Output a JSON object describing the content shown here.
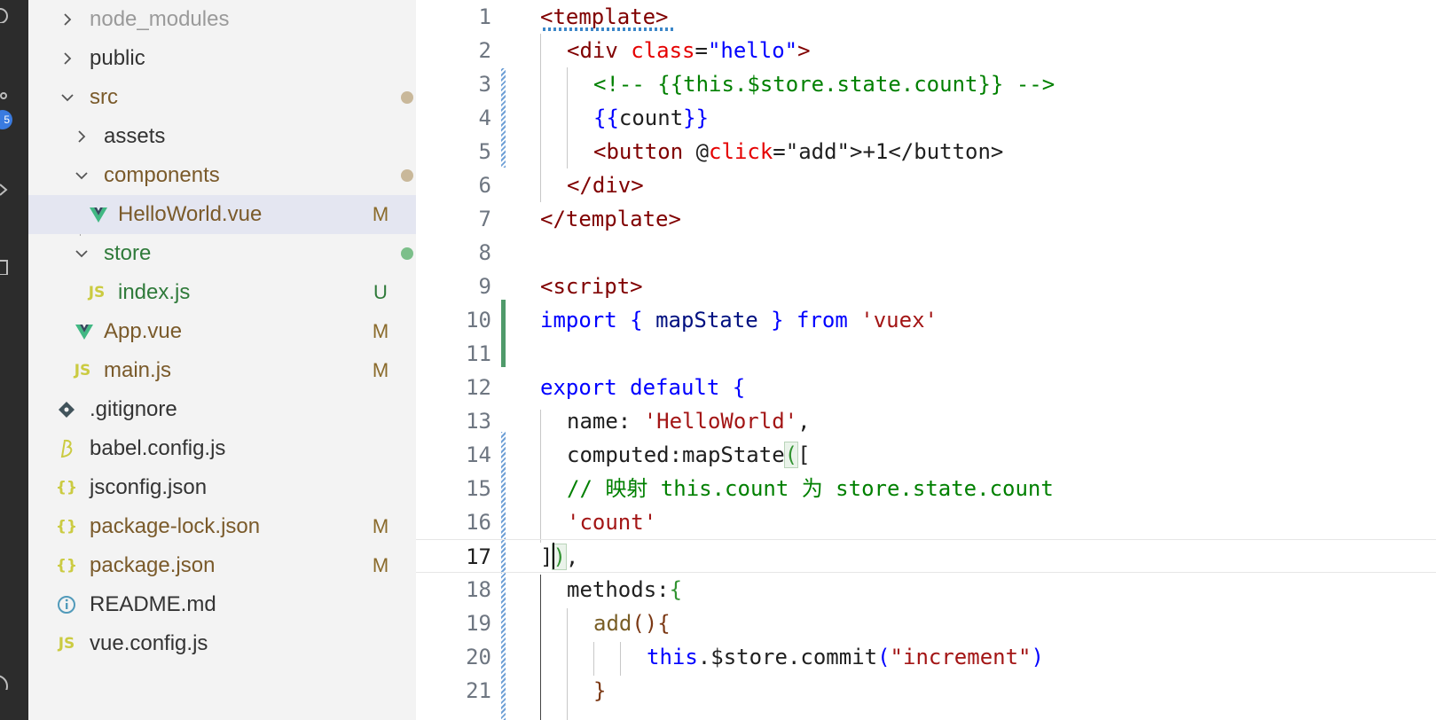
{
  "activity_bar": {
    "badge": "5"
  },
  "explorer": {
    "items": [
      {
        "label": "node_modules",
        "status": "",
        "type": "folder"
      },
      {
        "label": "public",
        "status": "",
        "type": "folder"
      },
      {
        "label": "src",
        "status": "",
        "type": "folder"
      },
      {
        "label": "assets",
        "status": "",
        "type": "folder"
      },
      {
        "label": "components",
        "status": "",
        "type": "folder"
      },
      {
        "label": "HelloWorld.vue",
        "status": "M",
        "type": "vue"
      },
      {
        "label": "store",
        "status": "",
        "type": "folder"
      },
      {
        "label": "index.js",
        "status": "U",
        "type": "js"
      },
      {
        "label": "App.vue",
        "status": "M",
        "type": "vue"
      },
      {
        "label": "main.js",
        "status": "M",
        "type": "js"
      },
      {
        "label": ".gitignore",
        "status": "",
        "type": "git"
      },
      {
        "label": "babel.config.js",
        "status": "",
        "type": "babel"
      },
      {
        "label": "jsconfig.json",
        "status": "",
        "type": "json"
      },
      {
        "label": "package-lock.json",
        "status": "M",
        "type": "json"
      },
      {
        "label": "package.json",
        "status": "M",
        "type": "json"
      },
      {
        "label": "README.md",
        "status": "",
        "type": "info"
      },
      {
        "label": "vue.config.js",
        "status": "",
        "type": "js"
      }
    ],
    "icons": {
      "js": "JS",
      "json": "{}",
      "vue": "V"
    }
  },
  "editor": {
    "line_numbers": [
      "1",
      "2",
      "3",
      "4",
      "5",
      "6",
      "7",
      "8",
      "9",
      "10",
      "11",
      "12",
      "13",
      "14",
      "15",
      "16",
      "17",
      "18",
      "19",
      "20",
      "21"
    ],
    "lines": {
      "l1": {
        "a": "<template>"
      },
      "l2": {
        "a": "<div ",
        "b": "class",
        "c": "=",
        "d": "\"hello\"",
        "e": ">"
      },
      "l3": {
        "a": "<!-- {{this.$store.state.count}} -->"
      },
      "l4": {
        "a": "{{",
        "b": "count",
        "c": "}}"
      },
      "l5": {
        "a": "<button ",
        "b": "@",
        "c": "click",
        "d": "=\"add\">+1</button>"
      },
      "l6": {
        "a": "</div>"
      },
      "l7": {
        "a": "</template>"
      },
      "l9": {
        "a": "<script>"
      },
      "l10": {
        "a": "import",
        "b": " { ",
        "c": "mapState",
        "d": " } ",
        "e": "from",
        "f": " ",
        "g": "'vuex'"
      },
      "l12": {
        "a": "export",
        "b": " ",
        "c": "default",
        "d": " {"
      },
      "l13": {
        "a": "name: ",
        "b": "'HelloWorld'",
        "c": ","
      },
      "l14": {
        "a": "computed:mapState",
        "b": "(",
        "c": "["
      },
      "l15": {
        "a": "// 映射 this.count 为 store.state.count"
      },
      "l16": {
        "a": "'count'"
      },
      "l17": {
        "a": "]",
        "b": ")",
        "c": ","
      },
      "l18": {
        "a": "methods:",
        "b": "{"
      },
      "l19": {
        "a": "add",
        "b": "(){"
      },
      "l20": {
        "a": "this",
        "b": ".$store.commit",
        "c": "(",
        "d": "\"increment\"",
        "e": ")"
      },
      "l21": {
        "a": "}"
      }
    }
  }
}
